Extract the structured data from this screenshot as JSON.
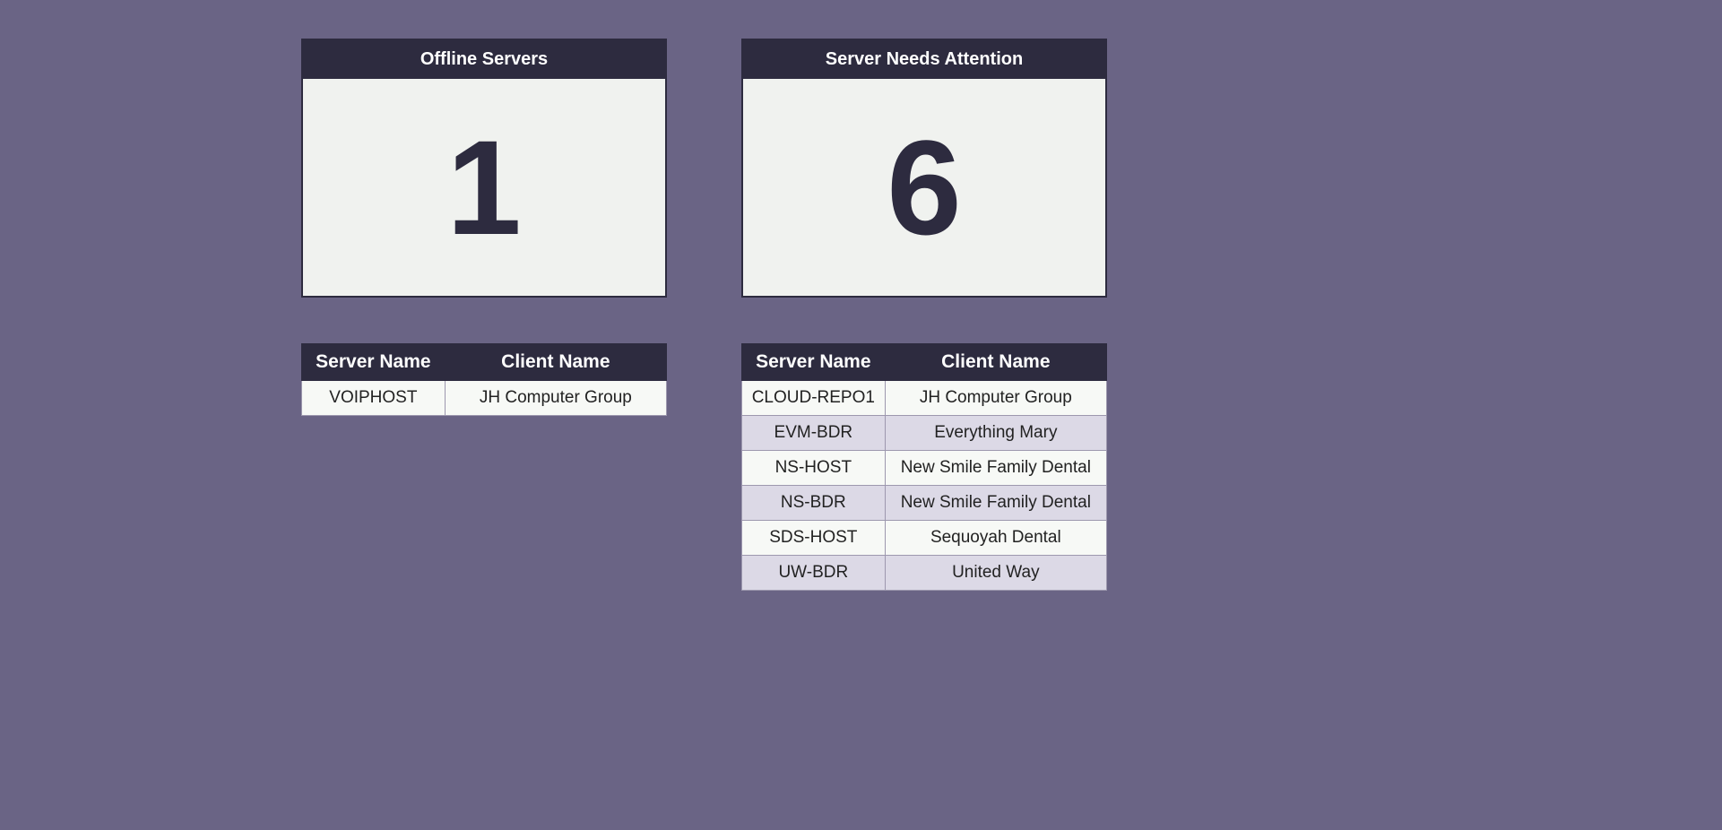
{
  "panels": {
    "offline": {
      "title": "Offline Servers",
      "count": "1",
      "columns": {
        "server": "Server Name",
        "client": "Client Name"
      },
      "rows": [
        {
          "server": "VOIPHOST",
          "client": "JH Computer Group"
        }
      ]
    },
    "attention": {
      "title": "Server Needs Attention",
      "count": "6",
      "columns": {
        "server": "Server Name",
        "client": "Client Name"
      },
      "rows": [
        {
          "server": "CLOUD-REPO1",
          "client": "JH Computer Group"
        },
        {
          "server": "EVM-BDR",
          "client": "Everything Mary"
        },
        {
          "server": "NS-HOST",
          "client": "New Smile Family Dental"
        },
        {
          "server": "NS-BDR",
          "client": "New Smile Family Dental"
        },
        {
          "server": "SDS-HOST",
          "client": "Sequoyah Dental"
        },
        {
          "server": "UW-BDR",
          "client": "United Way"
        }
      ]
    }
  }
}
